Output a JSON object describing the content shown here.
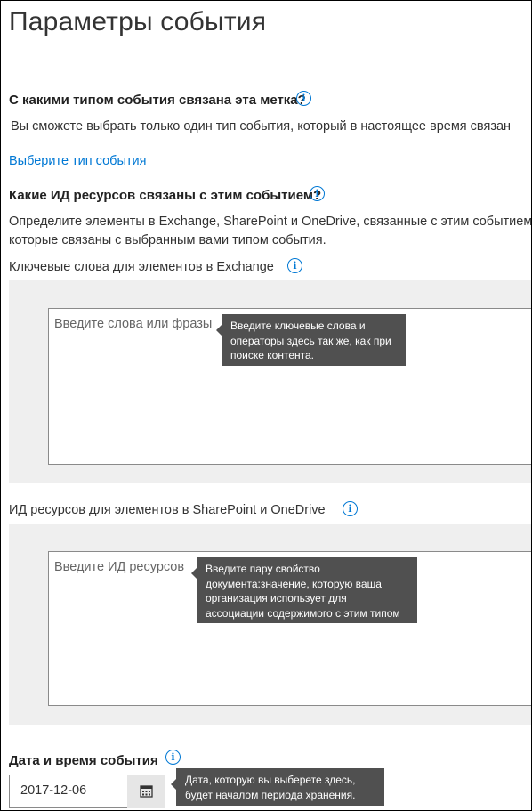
{
  "page": {
    "title": "Параметры события"
  },
  "event_type": {
    "question": "С какими типом события связана эта метка?",
    "description": "Вы сможете выбрать только один тип события, который в настоящее время связан",
    "link": "Выберите тип события"
  },
  "asset_ids": {
    "question": "Какие ИД ресурсов связаны с этим событием?",
    "description_line1": "Определите элементы в Exchange, SharePoint и OneDrive, связанные с этим событием",
    "description_line2": "которые связаны с выбранным вами типом события."
  },
  "exchange": {
    "label": "Ключевые слова для элементов в Exchange",
    "placeholder": "Введите слова или фразы",
    "tooltip": "Введите ключевые слова и операторы здесь так же, как при поиске контента."
  },
  "sharepoint": {
    "label": "ИД ресурсов для элементов в SharePoint и OneDrive",
    "placeholder": "Введите ИД ресурсов",
    "tooltip": "Введите пару свойство документа:значение, которую ваша организация использует для ассоциации содержимого с этим типом события."
  },
  "event_date": {
    "label": "Дата и время события",
    "value": "2017-12-06",
    "tooltip": "Дата, которую вы выберете здесь, будет началом периода хранения."
  },
  "icons": {
    "info": "info-icon",
    "calendar": "calendar-icon"
  },
  "colors": {
    "accent": "#0078d4",
    "tooltip_bg": "#505050",
    "panel_bg": "#efefef"
  }
}
